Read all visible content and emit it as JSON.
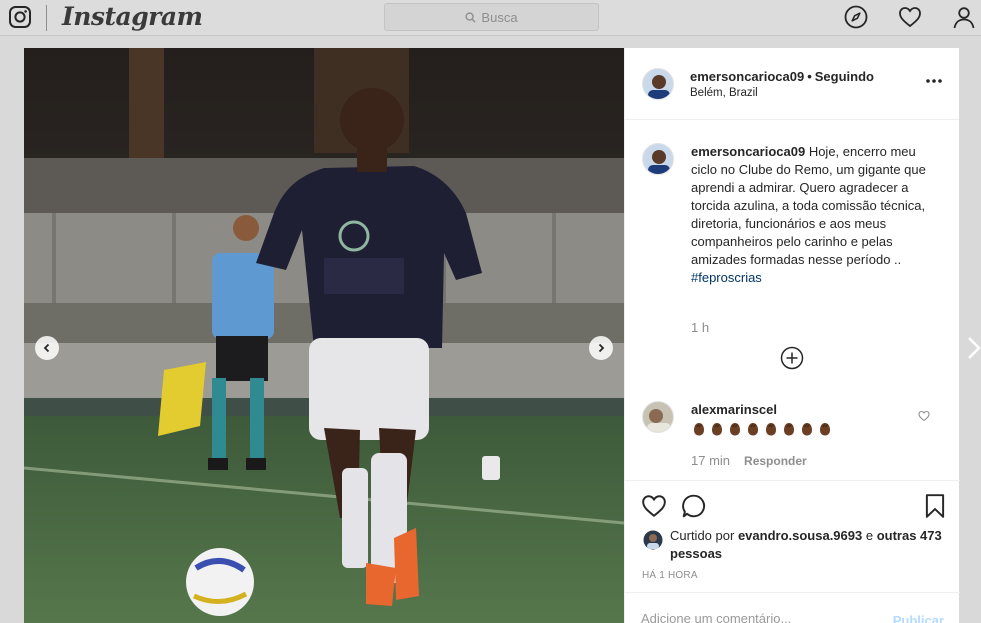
{
  "topbar": {
    "brand": "Instagram",
    "search_placeholder": "Busca",
    "icons": [
      "instagram-glyph-icon",
      "search-icon",
      "compass-icon",
      "heart-icon",
      "profile-icon"
    ]
  },
  "post": {
    "username": "emersoncarioca09",
    "follow_status": "Seguindo",
    "location": "Belém, Brazil",
    "caption_text": "Hoje, encerro meu ciclo no Clube do Remo, um gigante que aprendi a admirar. Quero agradecer a torcida azulina, a toda comissão técnica, diretoria, funcionários e aos meus companheiros pelo carinho e pelas amizades formadas nesse período ..",
    "hashtag": "#feproscrias",
    "caption_time": "1 h",
    "comments": [
      {
        "username": "alexmarinscel",
        "emoji_name": "clapping-hands-dark-skin-icon",
        "emoji_count": 8,
        "time": "17 min",
        "reply_label": "Responder"
      }
    ],
    "liked_by_prefix": "Curtido por",
    "liked_by_user": "evandro.sousa.9693",
    "liked_by_and": "e",
    "others_label": "outras 473 pessoas",
    "timestamp": "HÁ 1 HORA",
    "comment_placeholder": "Adicione um comentário...",
    "publish_label": "Publicar"
  },
  "colors": {
    "link": "#003569",
    "muted": "#8e8e8e",
    "publish_disabled": "#b3dbff",
    "jersey": "#1f1f33",
    "shoe": "#e8672e"
  }
}
